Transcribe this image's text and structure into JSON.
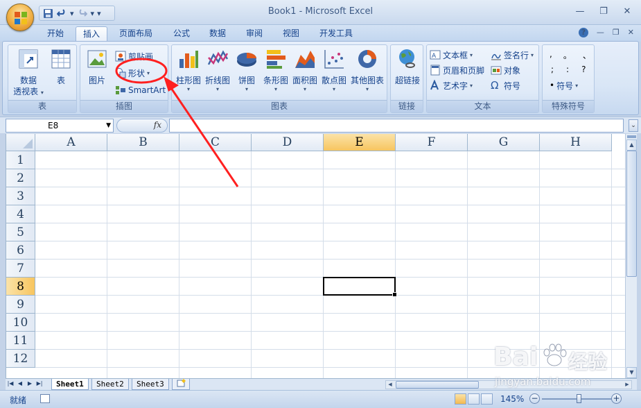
{
  "titlebar": {
    "title": "Book1 - Microsoft Excel",
    "qat_undo_caret": "▾",
    "qat_redo_caret": "▾",
    "qat_customize": "▾"
  },
  "tabs": [
    {
      "label": "开始"
    },
    {
      "label": "插入",
      "active": true
    },
    {
      "label": "页面布局"
    },
    {
      "label": "公式"
    },
    {
      "label": "数据"
    },
    {
      "label": "审阅"
    },
    {
      "label": "视图"
    },
    {
      "label": "开发工具"
    }
  ],
  "ribbon": {
    "tables": {
      "label": "表",
      "pivot_line1": "数据",
      "pivot_line2": "透视表",
      "table": "表"
    },
    "illustrations": {
      "label": "插图",
      "picture": "图片",
      "clipart": "剪贴画",
      "shapes": "形状",
      "smartart": "SmartArt"
    },
    "charts": {
      "label": "图表",
      "items": [
        "柱形图",
        "折线图",
        "饼图",
        "条形图",
        "面积图",
        "散点图",
        "其他图表"
      ]
    },
    "links": {
      "label": "链接",
      "hyperlink": "超链接"
    },
    "text": {
      "label": "文本",
      "textbox": "文本框",
      "header_footer": "页眉和页脚",
      "wordart": "艺术字",
      "signature": "签名行",
      "object": "对象",
      "symbol": "符号"
    },
    "special": {
      "label": "特殊符号",
      "row1": [
        ",",
        "。",
        "、"
      ],
      "row2": [
        ";",
        ":",
        "?"
      ],
      "symbol": "符号"
    }
  },
  "formula_bar": {
    "name_box": "E8",
    "fx": "fx",
    "formula": ""
  },
  "grid": {
    "columns": [
      "A",
      "B",
      "C",
      "D",
      "E",
      "F",
      "G",
      "H"
    ],
    "rows": [
      "1",
      "2",
      "3",
      "4",
      "5",
      "6",
      "7",
      "8",
      "9",
      "10",
      "11",
      "12"
    ],
    "selected_col": "E",
    "selected_row": "8"
  },
  "sheets": {
    "tabs": [
      "Sheet1",
      "Sheet2",
      "Sheet3"
    ],
    "active": "Sheet1"
  },
  "status": {
    "ready": "就绪",
    "zoom": "145%"
  },
  "watermark": {
    "brand": "Bai",
    "brand2": "经验",
    "url": "jingyan.baidu.com"
  },
  "colors": {
    "accent": "#15428b",
    "selection": "#f7c55f",
    "annotation": "#ff2020"
  }
}
